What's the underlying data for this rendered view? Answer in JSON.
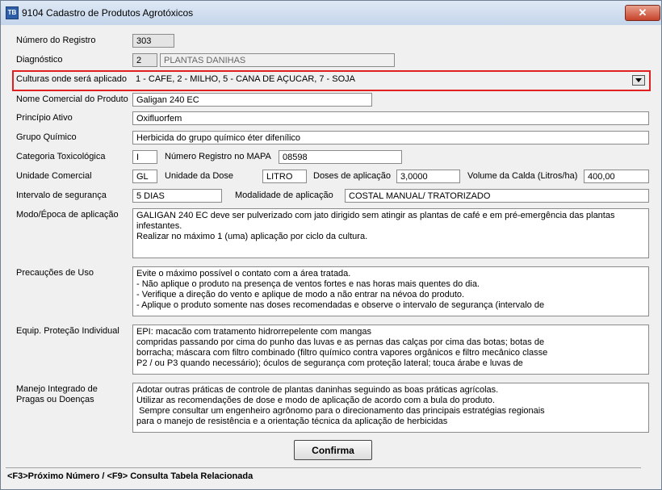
{
  "window": {
    "title": "9104 Cadastro de Produtos Agrotóxicos",
    "close_symbol": "✕",
    "icon_text": "TB"
  },
  "form": {
    "registro": {
      "label": "Número do Registro",
      "value": "303"
    },
    "diagnostico": {
      "label": "Diagnóstico",
      "code": "2",
      "value": "PLANTAS DANIHAS"
    },
    "culturas": {
      "label": "Culturas onde será aplicado",
      "value": "1 - CAFE, 2 - MILHO, 5 - CANA DE AÇUCAR, 7 - SOJA"
    },
    "nome_comercial": {
      "label": "Nome Comercial do Produto",
      "value": "Galigan 240 EC"
    },
    "principio_ativo": {
      "label": "Princípio Ativo",
      "value": "Oxifluorfem"
    },
    "grupo_quimico": {
      "label": "Grupo Químico",
      "value": "Herbicida do grupo químico éter difenílico"
    },
    "categoria": {
      "label": "Categoria Toxicológica",
      "value": "I"
    },
    "registro_mapa": {
      "label": "Número Registro no MAPA",
      "value": "08598"
    },
    "unidade_comercial": {
      "label": "Unidade Comercial",
      "value": "GL"
    },
    "unidade_dose": {
      "label": "Unidade da Dose",
      "value": "LITRO"
    },
    "doses": {
      "label": "Doses de aplicação",
      "value": "3,0000"
    },
    "volume_calda": {
      "label": "Volume da Calda (Litros/ha)",
      "value": "400,00"
    },
    "intervalo": {
      "label": "Intervalo de segurança",
      "value": "5 DIAS"
    },
    "modalidade": {
      "label": "Modalidade de aplicação",
      "value": "COSTAL MANUAL/ TRATORIZADO"
    },
    "modo_epoca": {
      "label": "Modo/Época de aplicação",
      "value": "GALIGAN 240 EC deve ser pulverizado com jato dirigido sem atingir as plantas de café e em pré-emergência das plantas infestantes.\nRealizar no máximo 1 (uma) aplicação por ciclo da cultura."
    },
    "precaucoes": {
      "label": "Precauções de Uso",
      "value": "Evite o máximo possível o contato com a área tratada.\n- Não aplique o produto na presença de ventos fortes e nas horas mais quentes do dia.\n- Verifique a direção do vento e aplique de modo a não entrar na névoa do produto.\n- Aplique o produto somente nas doses recomendadas e observe o intervalo de segurança (intervalo de"
    },
    "epi": {
      "label": "Equip. Proteção Individual",
      "value": "EPI: macacão com tratamento hidrorrepelente com mangas\ncompridas passando por cima do punho das luvas e as pernas das calças por cima das botas; botas de\nborracha; máscara com filtro combinado (filtro químico contra vapores orgânicos e filtro mecânico classe\nP2 / ou P3 quando necessário); óculos de segurança com proteção lateral; touca árabe e luvas de"
    },
    "manejo": {
      "label": "Manejo Integrado de Pragas ou Doenças",
      "value": "Adotar outras práticas de controle de plantas daninhas seguindo as boas práticas agrícolas.\nUtilizar as recomendações de dose e modo de aplicação de acordo com a bula do produto.\n Sempre consultar um engenheiro agrônomo para o direcionamento das principais estratégias regionais\npara o manejo de resistência e a orientação técnica da aplicação de herbicidas"
    }
  },
  "confirm_label": "Confirma",
  "status": "<F3>Próximo Número / <F9> Consulta Tabela Relacionada",
  "highlight_color": "#e02020"
}
